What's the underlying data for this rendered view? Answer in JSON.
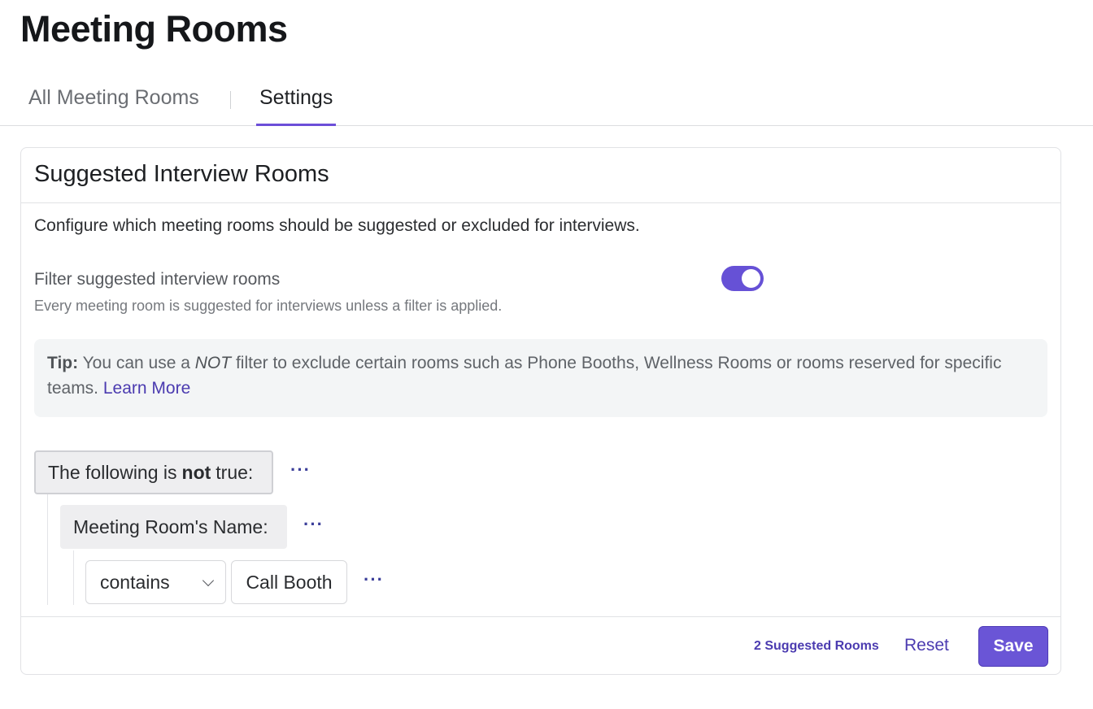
{
  "page": {
    "title": "Meeting Rooms"
  },
  "tabs": [
    {
      "label": "All Meeting Rooms",
      "active": false
    },
    {
      "label": "Settings",
      "active": true
    }
  ],
  "section": {
    "title": "Suggested Interview Rooms",
    "description": "Configure which meeting rooms should be suggested or excluded for interviews.",
    "filter": {
      "label": "Filter suggested interview rooms",
      "sublabel": "Every meeting room is suggested for interviews unless a filter is applied.",
      "enabled": true
    },
    "tip": {
      "prefix": "Tip:",
      "text_before": "You can use a",
      "keyword": "NOT",
      "text_after": "filter to exclude certain rooms such as Phone Booths, Wellness Rooms or rooms reserved for specific teams.",
      "link": "Learn More"
    },
    "rule": {
      "group_before": "The following is",
      "group_keyword": "not",
      "group_after": "true:",
      "field": "Meeting Room's Name:",
      "operator": "contains",
      "value": "Call Booth",
      "more": "···"
    },
    "footer": {
      "count": "2 Suggested Rooms",
      "reset": "Reset",
      "save": "Save"
    }
  },
  "colors": {
    "accent": "#6a55d6",
    "link": "#4b3bb0"
  }
}
